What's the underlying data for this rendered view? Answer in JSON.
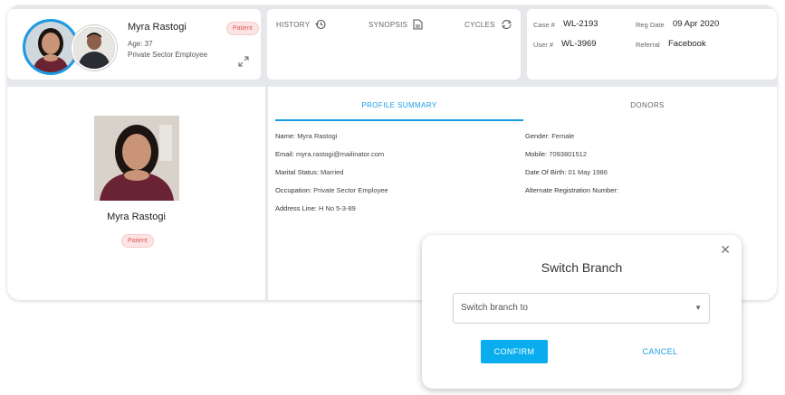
{
  "patient": {
    "name": "Myra Rastogi",
    "age": "Age: 37",
    "occupation": "Private Sector Employee",
    "badge": "Patient"
  },
  "header_tabs": {
    "history": "HISTORY",
    "synopsis": "SYNOPSIS",
    "cycles": "CYCLES"
  },
  "case_info": {
    "case_label": "Case #",
    "case_value": "WL-2193",
    "user_label": "User #",
    "user_value": "WL-3969",
    "reg_label": "Reg Date",
    "reg_value": "09 Apr 2020",
    "referral_label": "Referral",
    "referral_value": "Facebook"
  },
  "profile_card": {
    "name": "Myra Rastogi",
    "badge": "Patient"
  },
  "content_tabs": {
    "profile_summary": "PROFILE SUMMARY",
    "donors": "DONORS"
  },
  "profile_fields": {
    "name_label": "Name:",
    "name_value": "Myra Rastogi",
    "email_label": "Email:",
    "email_value": "myra.rastogi@mailinator.com",
    "marital_label": "Marital Status:",
    "marital_value": "Married",
    "occupation_label": "Occupation:",
    "occupation_value": "Private Sector Employee",
    "address_label": "Address Line:",
    "address_value": "H No 5-3-89",
    "gender_label": "Gender:",
    "gender_value": "Female",
    "mobile_label": "Mobile:",
    "mobile_value": "7093801512",
    "dob_label": "Date Of Birth:",
    "dob_value": "01 May 1986",
    "altreg_label": "Alternate Registration Number:",
    "altreg_value": ""
  },
  "modal": {
    "title": "Switch Branch",
    "close": "✕",
    "select_placeholder": "Switch branch to",
    "confirm": "CONFIRM",
    "cancel": "CANCEL"
  },
  "colors": {
    "accent": "#1a9be6",
    "confirm_bg": "#0aaeef",
    "badge_bg": "#fde4e4",
    "badge_text": "#e05858"
  }
}
